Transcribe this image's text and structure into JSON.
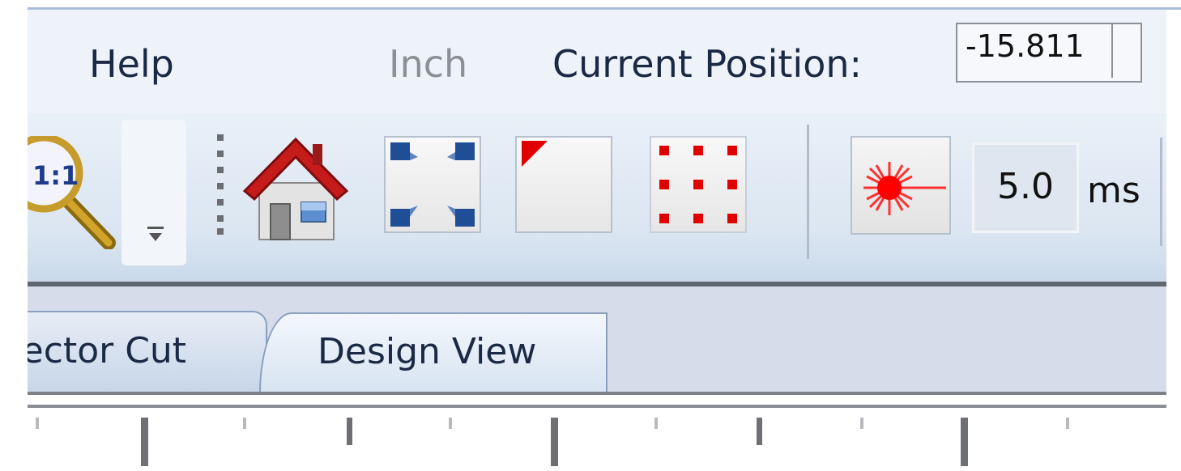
{
  "menu": {
    "help": "Help",
    "unit": "Inch",
    "position_label": "Current Position:",
    "position_x": "-15.811"
  },
  "toolbar": {
    "zoom_icon_text": "1:1",
    "icons": [
      "zoom-1to1-icon",
      "home-icon",
      "fit-corners-icon",
      "top-left-origin-icon",
      "dot-grid-icon",
      "laser-fire-icon"
    ],
    "pulse_value": "5.0",
    "pulse_unit": "ms"
  },
  "tabs": [
    {
      "label": "Vector Cut"
    },
    {
      "label": "Design View",
      "selected": true
    }
  ],
  "colors": {
    "menu_bg": "#eef3f9",
    "toolbar_bg": "#dbe6f2",
    "tab_area_bg": "#d7dceb",
    "accent_blue": "#1f4e96",
    "accent_red": "#e00000"
  }
}
